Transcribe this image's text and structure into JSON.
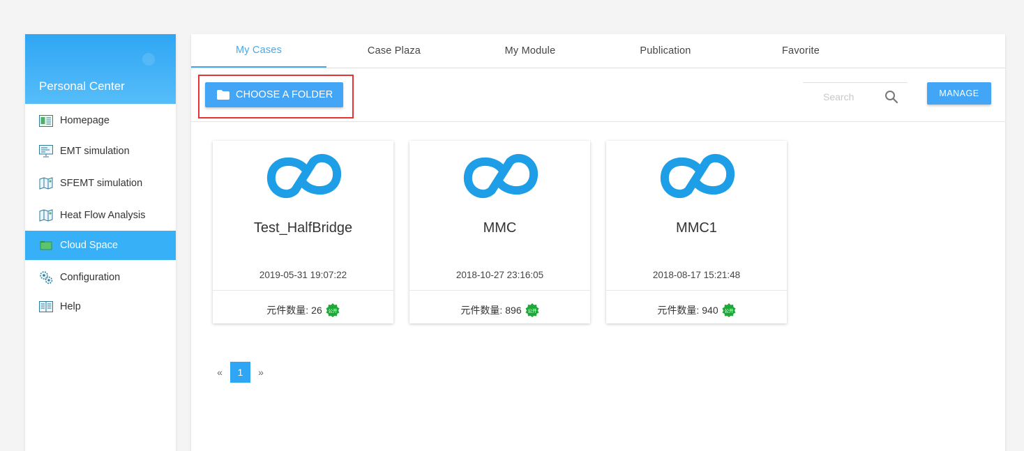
{
  "sidebar": {
    "title": "Personal Center",
    "items": [
      {
        "label": "Homepage",
        "icon": "homepage-icon"
      },
      {
        "label": "EMT simulation",
        "icon": "monitor-icon"
      },
      {
        "label": "SFEMT simulation",
        "icon": "map-icon"
      },
      {
        "label": "Heat Flow Analysis",
        "icon": "map-icon"
      },
      {
        "label": "Cloud Space",
        "icon": "cloud-folder-icon",
        "active": true
      },
      {
        "label": "Configuration",
        "icon": "gears-icon"
      },
      {
        "label": "Help",
        "icon": "book-icon"
      }
    ]
  },
  "tabs": [
    {
      "label": "My Cases",
      "active": true
    },
    {
      "label": "Case Plaza"
    },
    {
      "label": "My Module"
    },
    {
      "label": "Publication"
    },
    {
      "label": "Favorite"
    }
  ],
  "toolbar": {
    "choose_folder_label": "CHOOSE A FOLDER",
    "search_placeholder": "Search",
    "manage_label": "MANAGE"
  },
  "cards": [
    {
      "name": "Test_HalfBridge",
      "date": "2019-05-31 19:07:22",
      "count_label": "元件数量:",
      "count": "26",
      "badge": "公开"
    },
    {
      "name": "MMC",
      "date": "2018-10-27 23:16:05",
      "count_label": "元件数量:",
      "count": "896",
      "badge": "公开"
    },
    {
      "name": "MMC1",
      "date": "2018-08-17 15:21:48",
      "count_label": "元件数量:",
      "count": "940",
      "badge": "公开"
    }
  ],
  "pagination": {
    "prev": "«",
    "current": "1",
    "next": "»"
  },
  "colors": {
    "accent": "#42a5f5",
    "sidebar_active": "#38b0f8",
    "highlight": "#e53333",
    "logo": "#1e9ee6",
    "badge": "#1fa83a"
  }
}
